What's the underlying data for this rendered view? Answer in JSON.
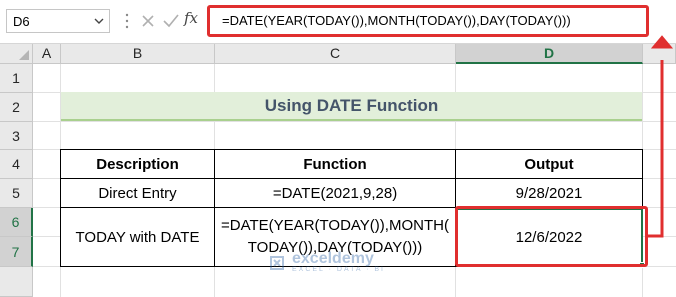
{
  "formula_bar": {
    "name_box": "D6",
    "fx_label": "fx",
    "formula": "=DATE(YEAR(TODAY()),MONTH(TODAY()),DAY(TODAY()))"
  },
  "columns": [
    "A",
    "B",
    "C",
    "D"
  ],
  "rows": [
    "1",
    "2",
    "3",
    "4",
    "5",
    "6",
    "7"
  ],
  "selected_column": "D",
  "selected_rows": [
    "6",
    "7"
  ],
  "title": "Using DATE Function",
  "table": {
    "headers": [
      "Description",
      "Function",
      "Output"
    ],
    "rows": [
      {
        "description": "Direct Entry",
        "function": "=DATE(2021,9,28)",
        "output": "9/28/2021"
      },
      {
        "description": "TODAY with DATE",
        "function_line1": "=DATE(YEAR(TODAY()),MONTH(",
        "function_line2": "TODAY()),DAY(TODAY()))",
        "output": "12/6/2022"
      }
    ]
  },
  "watermark": {
    "name": "exceldemy",
    "tagline": "EXCEL · DATA · BI"
  },
  "colors": {
    "title_fill": "#e2efda",
    "title_text": "#44546a",
    "annotation_red": "#e02f2f",
    "excel_green": "#217346"
  }
}
